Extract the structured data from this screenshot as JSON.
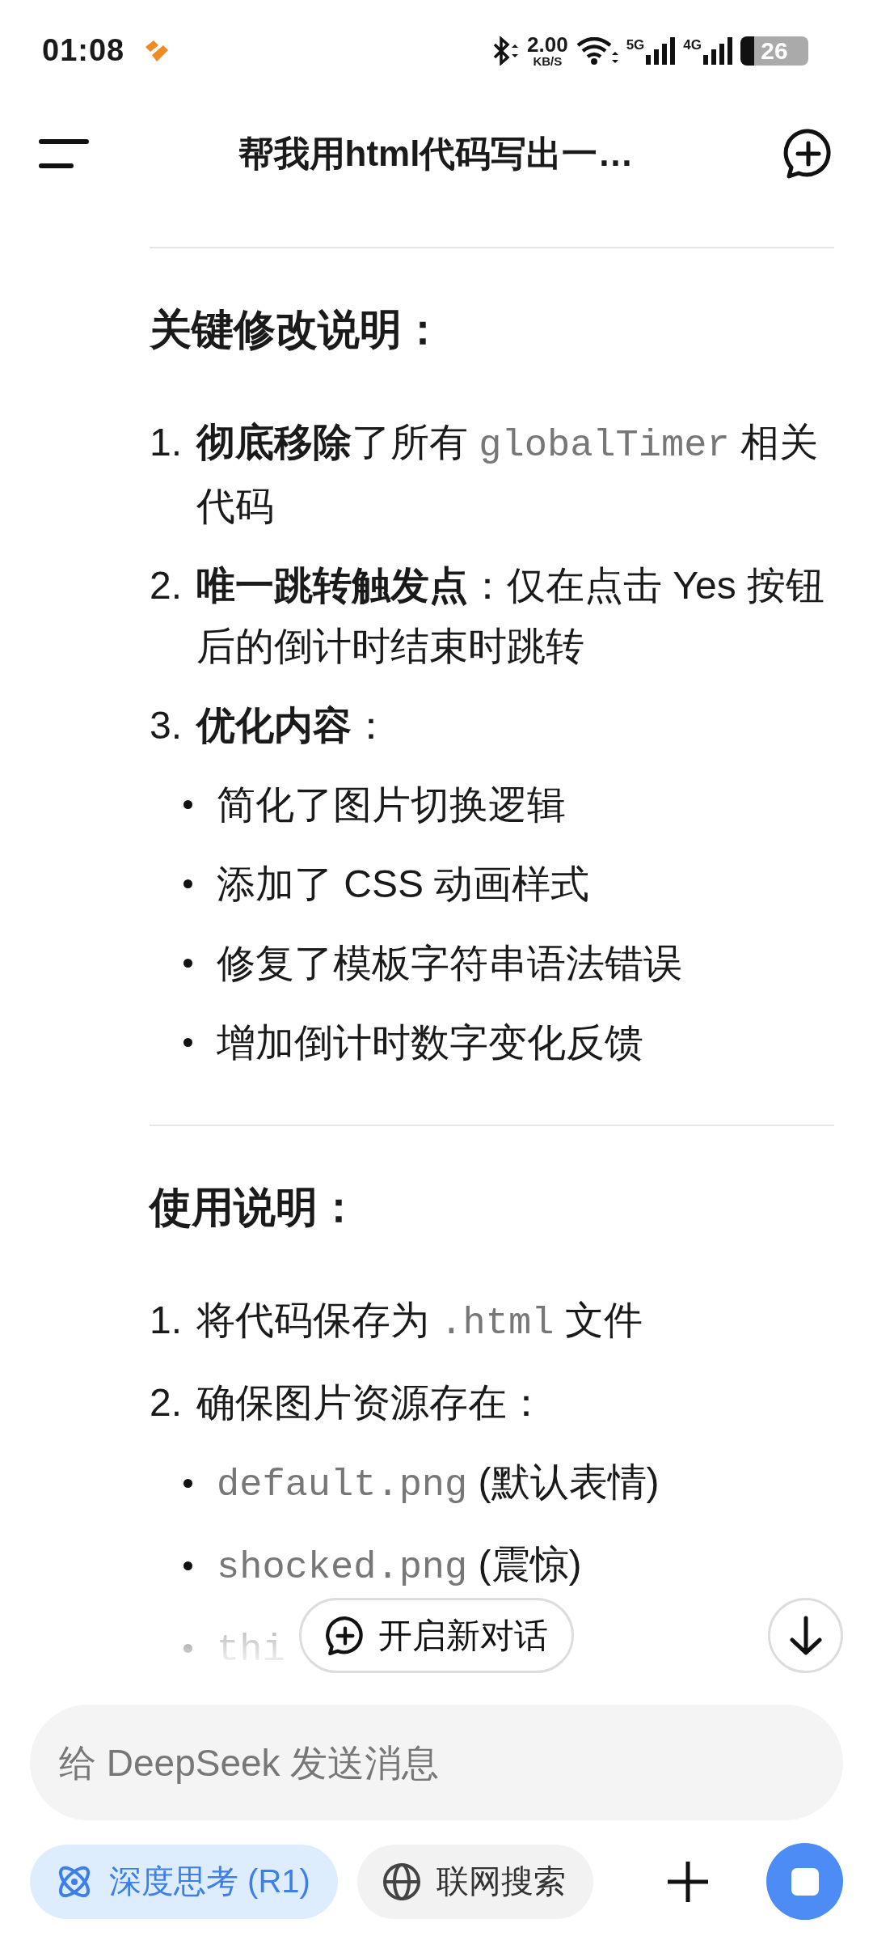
{
  "status_bar": {
    "time": "01:08",
    "net_speed": "2.00",
    "net_unit": "KB/S",
    "networks": [
      "5G",
      "4G"
    ],
    "battery": "26"
  },
  "top_bar": {
    "title": "帮我用html代码写出一…"
  },
  "sections": [
    {
      "heading": "关键修改说明：",
      "items": [
        {
          "number": "1.",
          "segments": [
            {
              "text": "彻底移除",
              "kind": "bold"
            },
            {
              "text": "了所有 ",
              "kind": "plain"
            },
            {
              "text": "globalTimer",
              "kind": "code"
            },
            {
              "text": " 相关代码",
              "kind": "plain"
            }
          ]
        },
        {
          "number": "2.",
          "segments": [
            {
              "text": "唯一跳转触发点",
              "kind": "bold"
            },
            {
              "text": "：仅在点击 Yes 按钮后的倒计时结束时跳转",
              "kind": "plain"
            }
          ]
        },
        {
          "number": "3.",
          "segments": [
            {
              "text": "优化内容",
              "kind": "bold"
            },
            {
              "text": "：",
              "kind": "plain"
            }
          ],
          "children": [
            {
              "segments": [
                {
                  "text": "简化了图片切换逻辑",
                  "kind": "plain"
                }
              ]
            },
            {
              "segments": [
                {
                  "text": "添加了 CSS 动画样式",
                  "kind": "plain"
                }
              ]
            },
            {
              "segments": [
                {
                  "text": "修复了模板字符串语法错误",
                  "kind": "plain"
                }
              ]
            },
            {
              "segments": [
                {
                  "text": "增加倒计时数字变化反馈",
                  "kind": "plain"
                }
              ]
            }
          ]
        }
      ]
    },
    {
      "heading": "使用说明：",
      "items": [
        {
          "number": "1.",
          "segments": [
            {
              "text": "将代码保存为 ",
              "kind": "plain"
            },
            {
              "text": ".html",
              "kind": "code"
            },
            {
              "text": " 文件",
              "kind": "plain"
            }
          ]
        },
        {
          "number": "2.",
          "segments": [
            {
              "text": "确保图片资源存在：",
              "kind": "plain"
            }
          ],
          "children": [
            {
              "segments": [
                {
                  "text": "default.png",
                  "kind": "code"
                },
                {
                  "text": " (默认表情)",
                  "kind": "plain"
                }
              ]
            },
            {
              "segments": [
                {
                  "text": "shocked.png",
                  "kind": "code"
                },
                {
                  "text": " (震惊)",
                  "kind": "plain"
                }
              ]
            },
            {
              "segments": [
                {
                  "text": "thi",
                  "kind": "code"
                }
              ]
            }
          ]
        }
      ]
    }
  ],
  "floating": {
    "new_chat": "开启新对话"
  },
  "composer": {
    "placeholder": "给 DeepSeek 发送消息",
    "chips": [
      {
        "label": "深度思考 (R1)",
        "selected": true,
        "kind": "think"
      },
      {
        "label": "联网搜索",
        "selected": false,
        "kind": "web"
      }
    ]
  }
}
